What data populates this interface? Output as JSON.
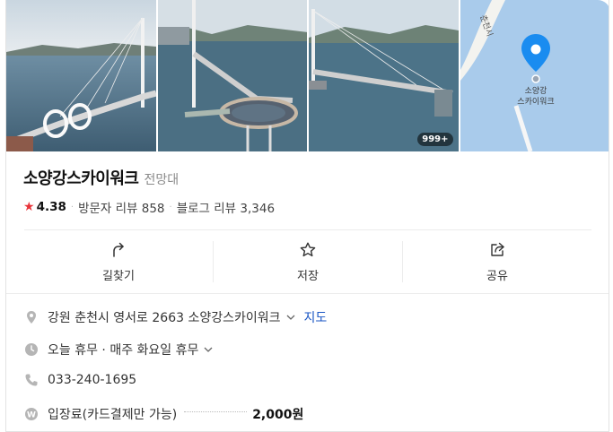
{
  "photos": {
    "more_count": "999+",
    "map_pin_label": "소양강\n스카이워크",
    "map_road_label": "춘천시"
  },
  "place": {
    "name": "소양강스카이워크",
    "category": "전망대"
  },
  "rating": {
    "score": "4.38",
    "visitor_reviews": "방문자 리뷰 858",
    "blog_reviews": "블로그 리뷰 3,346"
  },
  "actions": [
    {
      "label": "길찾기",
      "icon": "directions-icon"
    },
    {
      "label": "저장",
      "icon": "star-outline-icon"
    },
    {
      "label": "공유",
      "icon": "share-icon"
    }
  ],
  "info": {
    "address": "강원 춘천시 영서로 2663 소양강스카이워크",
    "map_link": "지도",
    "hours": "오늘 휴무 · 매주 화요일 휴무",
    "phone": "033-240-1695",
    "fee_label": "입장료(카드결제만 가능)",
    "fee_price": "2,000원"
  },
  "colors": {
    "accent_star": "#e8343a",
    "link": "#1a56c4",
    "map_water": "#a9cbeb",
    "pin": "#1a8cf0"
  }
}
